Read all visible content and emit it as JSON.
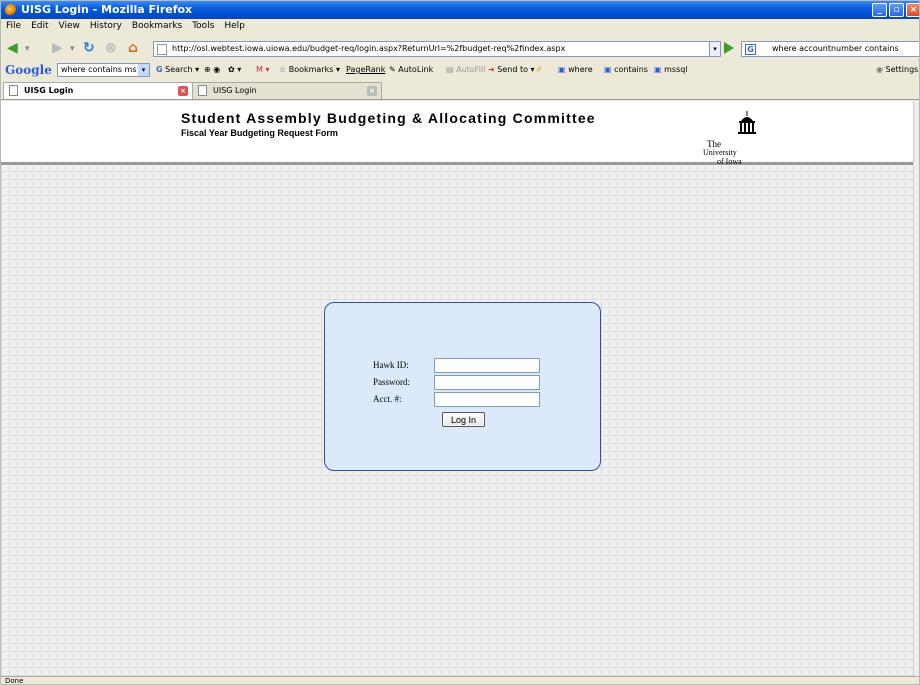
{
  "window": {
    "title": "UISG Login - Mozilla Firefox"
  },
  "menu": {
    "items": [
      "File",
      "Edit",
      "View",
      "History",
      "Bookmarks",
      "Tools",
      "Help"
    ]
  },
  "navigation": {
    "url": "http://osl.webtest.iowa.uiowa.edu/budget-req/login.aspx?ReturnUrl=%2fbudget-req%2findex.aspx",
    "search_value": "where accountnumber contains"
  },
  "google_toolbar": {
    "search_combo_value": "where contains ms",
    "items": {
      "search": "Search",
      "bookmarks": "Bookmarks",
      "pagerank": "PageRank",
      "autolink": "AutoLink",
      "autofill": "AutoFill",
      "sendto": "Send to",
      "where": "where",
      "contains": "contains",
      "mssql": "mssql",
      "settings": "Settings"
    }
  },
  "tabs": [
    {
      "label": "UISG Login",
      "active": true
    },
    {
      "label": "UISG Login",
      "active": false
    }
  ],
  "header": {
    "title": "Student Assembly Budgeting & Allocating Committee",
    "subtitle": "Fiscal Year Budgeting Request Form",
    "logo_line1": "The",
    "logo_line2": "University",
    "logo_line3": "of Iowa"
  },
  "login": {
    "hawk_id_label": "Hawk ID:",
    "password_label": "Password:",
    "acct_label": "Acct. #:",
    "hawk_id_value": "",
    "password_value": "",
    "acct_value": "",
    "button_label": "Log In"
  },
  "status": {
    "text": "Done"
  }
}
